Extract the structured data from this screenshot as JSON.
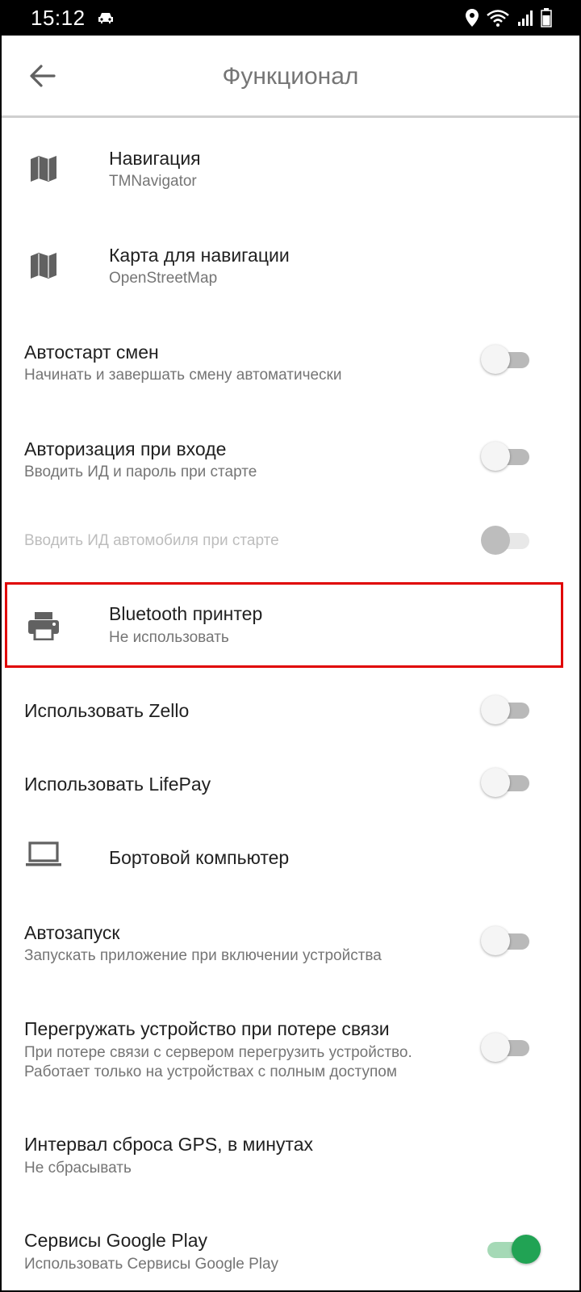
{
  "status_bar": {
    "time": "15:12",
    "icons": [
      "car-icon",
      "location-icon",
      "wifi-icon",
      "signal-icon",
      "battery-icon"
    ]
  },
  "app_bar": {
    "title": "Функционал",
    "back_icon": "arrow-back-icon"
  },
  "settings": [
    {
      "id": "navigation",
      "icon": "map-icon",
      "title": "Навигация",
      "subtitle": "TMNavigator"
    },
    {
      "id": "map",
      "icon": "map-icon",
      "title": "Карта для навигации",
      "subtitle": "OpenStreetMap"
    },
    {
      "id": "autostart-shift",
      "title": "Автостарт смен",
      "subtitle": "Начинать и завершать смену автоматически",
      "toggle": false
    },
    {
      "id": "login-auth",
      "title": "Авторизация при входе",
      "subtitle": "Вводить ИД и пароль при старте",
      "toggle": false
    },
    {
      "id": "car-id",
      "subtitle": "Вводить ИД автомобиля при старте",
      "toggle": false,
      "disabled": true
    },
    {
      "id": "bluetooth-printer",
      "icon": "printer-icon",
      "title": "Bluetooth принтер",
      "subtitle": "Не использовать",
      "highlighted": true
    },
    {
      "id": "zello",
      "title": "Использовать Zello",
      "toggle": false
    },
    {
      "id": "lifepay",
      "title": "Использовать LifePay",
      "toggle": false
    },
    {
      "id": "onboard-computer",
      "icon": "laptop-icon",
      "title": "Бортовой компьютер"
    },
    {
      "id": "autolaunch",
      "title": "Автозапуск",
      "subtitle": "Запускать приложение при включении устройства",
      "toggle": false
    },
    {
      "id": "reboot",
      "title": "Перегружать устройство при потере связи",
      "subtitle_lines": [
        "При потере связи с сервером перегрузить устройство.",
        "Работает только на устройствах с полным доступом"
      ],
      "toggle": false
    },
    {
      "id": "gps-reset",
      "title": "Интервал сброса GPS, в минутах",
      "subtitle": "Не сбрасывать"
    },
    {
      "id": "google-play",
      "title": "Сервисы Google Play",
      "subtitle": "Использовать Сервисы Google Play",
      "toggle": true
    }
  ],
  "colors": {
    "highlight_border": "#e00000",
    "toggle_on": "#21a354",
    "toggle_off_track": "#b9b9b9"
  }
}
